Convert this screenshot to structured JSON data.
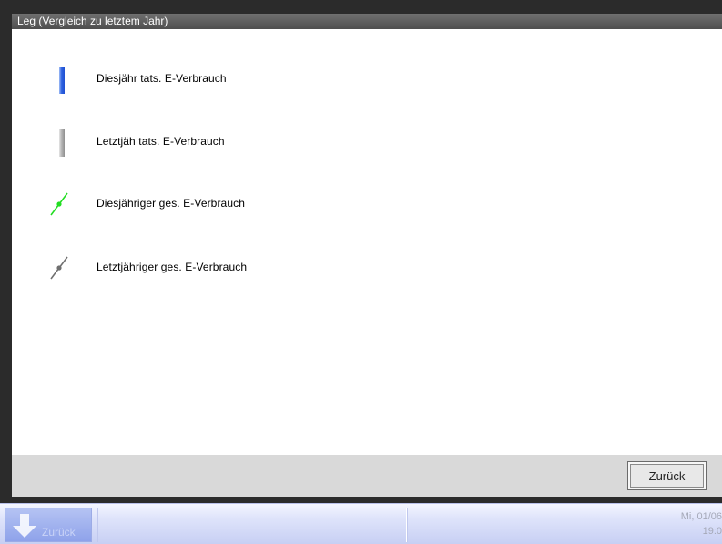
{
  "window": {
    "title": "Leg (Vergleich zu letztem Jahr)"
  },
  "legend": {
    "items": [
      {
        "label": "Diesjähr tats. E-Verbrauch",
        "symbol": "bar",
        "color": "#2f63e0"
      },
      {
        "label": "Letztjäh tats. E-Verbrauch",
        "symbol": "bar",
        "color": "#a0a0a0"
      },
      {
        "label": "Diesjähriger ges. E-Verbrauch",
        "symbol": "line-marker",
        "color": "#22dd22"
      },
      {
        "label": "Letztjähriger ges. E-Verbrauch",
        "symbol": "line-marker",
        "color": "#6f6f6f"
      }
    ]
  },
  "footer": {
    "back_label": "Zurück"
  },
  "taskbar": {
    "back_label": "Zurück",
    "date": "Mi, 01/06",
    "time": "19:0"
  }
}
